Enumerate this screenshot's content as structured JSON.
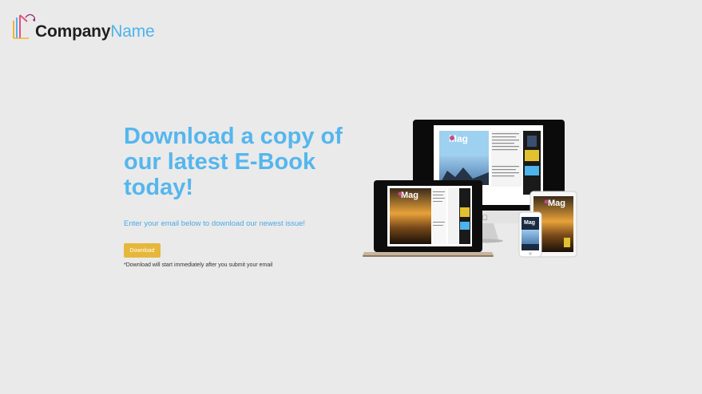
{
  "logo": {
    "company": "Company",
    "name": "Name"
  },
  "hero": {
    "headline": "Download a copy of our latest E-Book today!",
    "subtext": "Enter your email below to download our newest issue!",
    "button_label": "Download",
    "note": "*Download will start immediately after you submit your email"
  },
  "mockup": {
    "mag_title": "Mag"
  },
  "colors": {
    "accent": "#55b6ee",
    "button": "#e6b73a",
    "background": "#eaeaea"
  }
}
